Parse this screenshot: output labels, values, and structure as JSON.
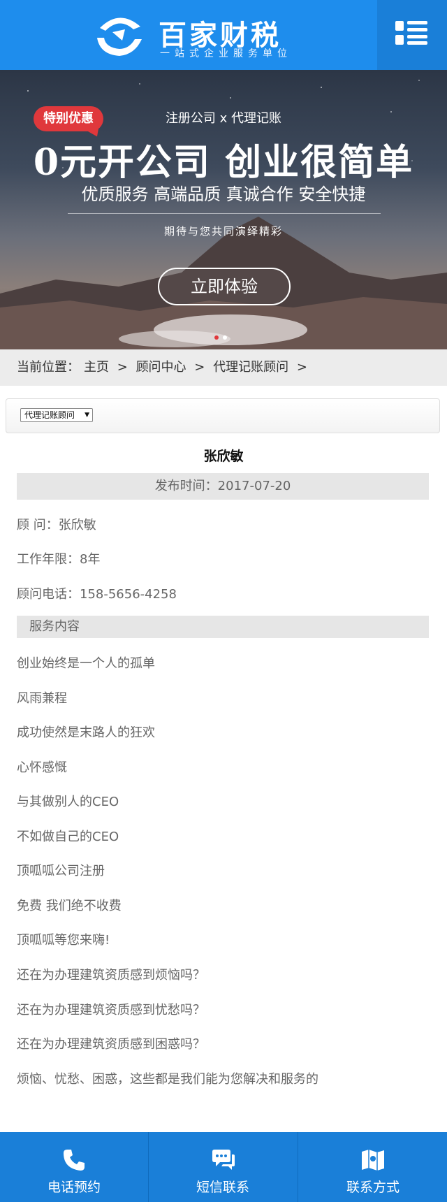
{
  "header": {
    "brand_name": "百家财税",
    "brand_slogan": "一站式企业服务单位",
    "menu_icon": "menu-grid-icon",
    "color": "#1e8ded"
  },
  "banner": {
    "badge": "特别优惠",
    "top_line": "注册公司 x 代理记账",
    "headline": "0元开公司 创业很简单",
    "subline": "优质服务 高端品质 真诚合作  安全快捷",
    "tagline": "期待与您共同演绎精彩",
    "cta": "立即体验",
    "active_slide": 1,
    "slide_count": 2
  },
  "breadcrumb": {
    "prefix": "当前位置：",
    "items": [
      "主页",
      "顾问中心",
      "代理记账顾问"
    ],
    "separator": ">"
  },
  "filter": {
    "selected": "代理记账顾问"
  },
  "article": {
    "title": "张欣敏",
    "publish": "发布时间：2017-07-20",
    "info": [
      "顾 问：张欣敏",
      "工作年限：8年",
      "顾问电话：158-5656-4258"
    ],
    "section_title": "服务内容",
    "lines": [
      "创业始终是一个人的孤单",
      "风雨兼程",
      "成功使然是末路人的狂欢",
      "心怀感慨",
      "与其做别人的CEO",
      "不如做自己的CEO",
      "顶呱呱公司注册",
      "免费   我们绝不收费",
      "顶呱呱等您来嗨!",
      "还在为办理建筑资质感到烦恼吗？",
      "还在为办理建筑资质感到忧愁吗？",
      "还在为办理建筑资质感到困惑吗？",
      "烦恼、忧愁、困惑，这些都是我们能为您解决和服务的"
    ]
  },
  "bottom_nav": {
    "items": [
      {
        "label": "电话预约",
        "icon": "phone-icon"
      },
      {
        "label": "短信联系",
        "icon": "chat-icon"
      },
      {
        "label": "联系方式",
        "icon": "map-icon"
      }
    ],
    "color": "#1a7fd8"
  }
}
